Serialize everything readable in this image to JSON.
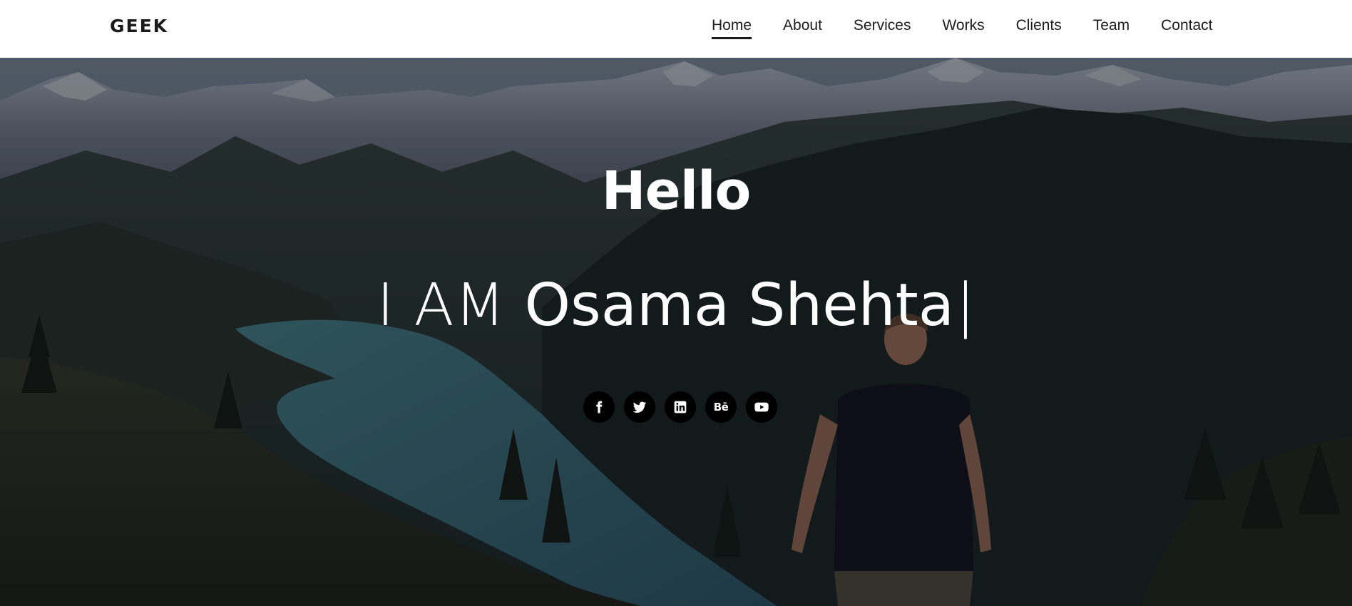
{
  "brand": "GEEK",
  "nav": {
    "items": [
      {
        "label": "Home",
        "active": true
      },
      {
        "label": "About",
        "active": false
      },
      {
        "label": "Services",
        "active": false
      },
      {
        "label": "Works",
        "active": false
      },
      {
        "label": "Clients",
        "active": false
      },
      {
        "label": "Team",
        "active": false
      },
      {
        "label": "Contact",
        "active": false
      }
    ]
  },
  "hero": {
    "greeting": "Hello",
    "prefix": "I AM",
    "name": "Osama Shehta",
    "cursor": "|",
    "background": "mountain-lake-landscape-photo"
  },
  "social": {
    "icons": [
      "facebook-icon",
      "twitter-icon",
      "linkedin-icon",
      "behance-icon",
      "youtube-icon"
    ],
    "behance_glyph": "Bē"
  },
  "colors": {
    "nav_bg": "#ffffff",
    "nav_text": "#1c1c1c",
    "hero_text": "#ffffff",
    "social_bg": "#000000"
  }
}
